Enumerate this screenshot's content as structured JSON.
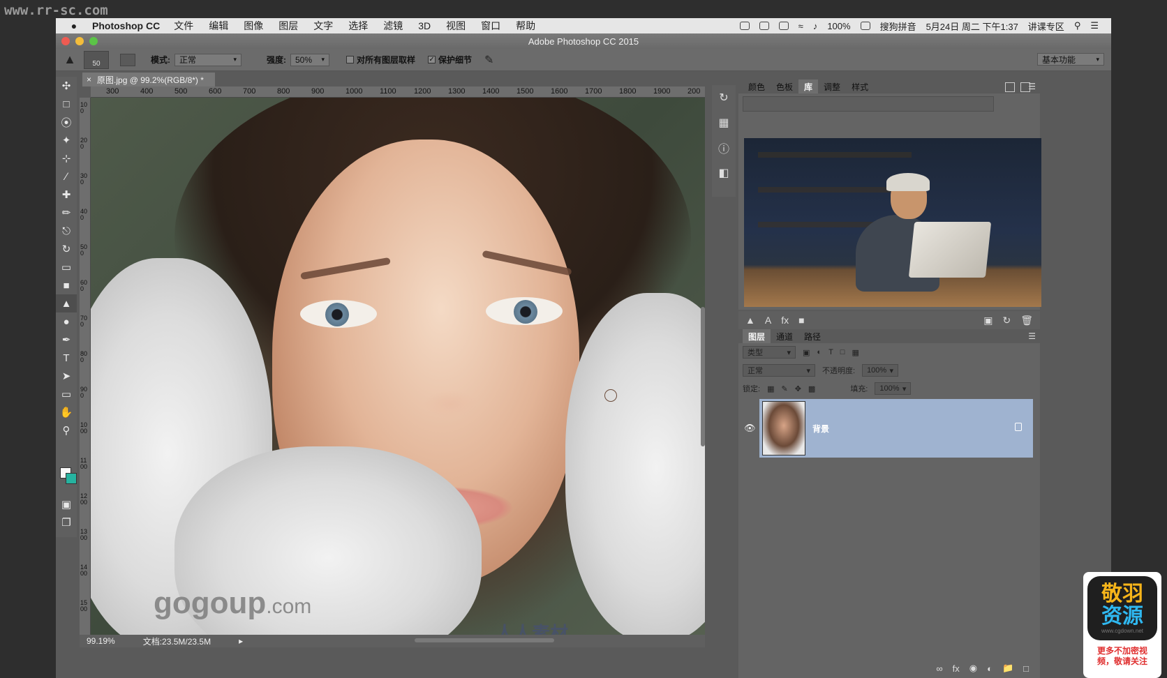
{
  "site_watermark": "www.rr-sc.com",
  "menubar": {
    "app_name": "Photoshop CC",
    "items": [
      "文件",
      "编辑",
      "图像",
      "图层",
      "文字",
      "选择",
      "滤镜",
      "3D",
      "视图",
      "窗口",
      "帮助"
    ],
    "battery": "100%",
    "input_method": "搜狗拼音",
    "datetime": "5月24日 周二 下午1:37",
    "user": "讲课专区"
  },
  "window": {
    "title": "Adobe Photoshop CC 2015"
  },
  "options_bar": {
    "brush_size": "50",
    "mode_label": "模式:",
    "mode_value": "正常",
    "strength_label": "强度:",
    "strength_value": "50%",
    "sample_all_label": "对所有图层取样",
    "protect_detail_label": "保护细节",
    "workspace": "基本功能"
  },
  "document": {
    "tab_title": "原图.jpg @ 99.2%(RGB/8*) *",
    "ruler_top": [
      "300",
      "400",
      "500",
      "600",
      "700",
      "800",
      "900",
      "1000",
      "1100",
      "1200",
      "1300",
      "1400",
      "1500",
      "1600",
      "1700",
      "1800",
      "1900",
      "200"
    ],
    "ruler_left": [
      "100",
      "200",
      "300",
      "400",
      "500",
      "600",
      "700",
      "800",
      "900",
      "1000",
      "1100",
      "1200",
      "1300",
      "1400",
      "1500"
    ],
    "zoom": "99.19%",
    "doc_size": "文档:23.5M/23.5M"
  },
  "image_watermarks": {
    "gogoup": "gogoup",
    "gogoup_suffix": ".com",
    "rr": "人人素材"
  },
  "library_panel": {
    "tabs": [
      "颜色",
      "色板",
      "库",
      "调整",
      "样式"
    ],
    "active_tab": "库"
  },
  "layers_panel": {
    "tabs": [
      "图层",
      "通道",
      "路径"
    ],
    "active_tab": "图层",
    "filter_label": "类型",
    "blend_mode": "正常",
    "opacity_label": "不透明度:",
    "opacity_value": "100%",
    "lock_label": "锁定:",
    "fill_label": "填充:",
    "fill_value": "100%",
    "layer_name": "背景"
  },
  "logo": {
    "line1": "敬羽",
    "line2": "资源",
    "site": "www.cgdown.net",
    "promo1": "更多不加密视",
    "promo2": "频，敬请关注"
  }
}
